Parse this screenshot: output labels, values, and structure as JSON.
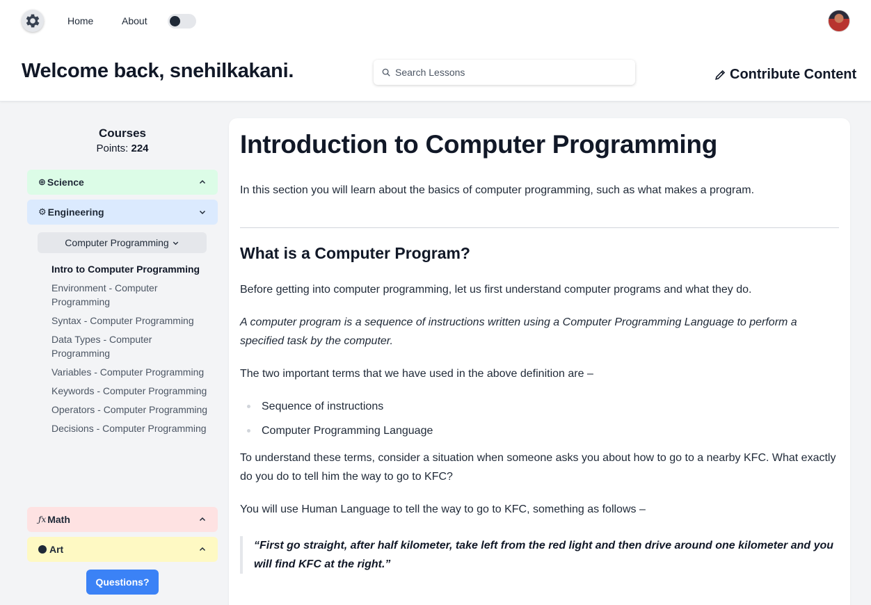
{
  "nav": {
    "home": "Home",
    "about": "About"
  },
  "header": {
    "welcome": "Welcome back, snehilkakani.",
    "search_placeholder": "Search Lessons",
    "contribute": "Contribute Content"
  },
  "sidebar": {
    "title": "Courses",
    "points_label": "Points: ",
    "points_value": "224",
    "courses": [
      {
        "label": "Science",
        "color": "#dcfce7",
        "expanded": false
      },
      {
        "label": "Engineering",
        "color": "#dbeafe",
        "expanded": true
      },
      {
        "label": "Math",
        "color": "#fee2e2",
        "expanded": false
      },
      {
        "label": "Art",
        "color": "#fef9c3",
        "expanded": false
      }
    ],
    "subcourse": "Computer Programming",
    "lessons": [
      "Intro to Computer Programming",
      "Environment - Computer Programming",
      "Syntax - Computer Programming",
      "Data Types - Computer Programming",
      "Variables - Computer Programming",
      "Keywords - Computer Programming",
      "Operators - Computer Programming",
      "Decisions - Computer Programming"
    ],
    "questions_button": "Questions?"
  },
  "content": {
    "title": "Introduction to Computer Programming",
    "intro": "In this section you will learn about the basics of computer programming, such as what makes a program.",
    "heading": "What is a Computer Program?",
    "p1": "Before getting into computer programming, let us first understand computer programs and what they do.",
    "definition": "A computer program is a sequence of instructions written using a Computer Programming Language to perform a specified task by the computer.",
    "p2": "The two important terms that we have used in the above definition are –",
    "bullets": [
      "Sequence of instructions",
      "Computer Programming Language"
    ],
    "p3": "To understand these terms, consider a situation when someone asks you about how to go to a nearby KFC. What exactly do you do to tell him the way to go to KFC?",
    "p4": "You will use Human Language to tell the way to go to KFC, something as follows –",
    "quote": "“First go straight, after half kilometer, take left from the red light and then drive around one kilometer and you will find KFC at the right.”"
  }
}
